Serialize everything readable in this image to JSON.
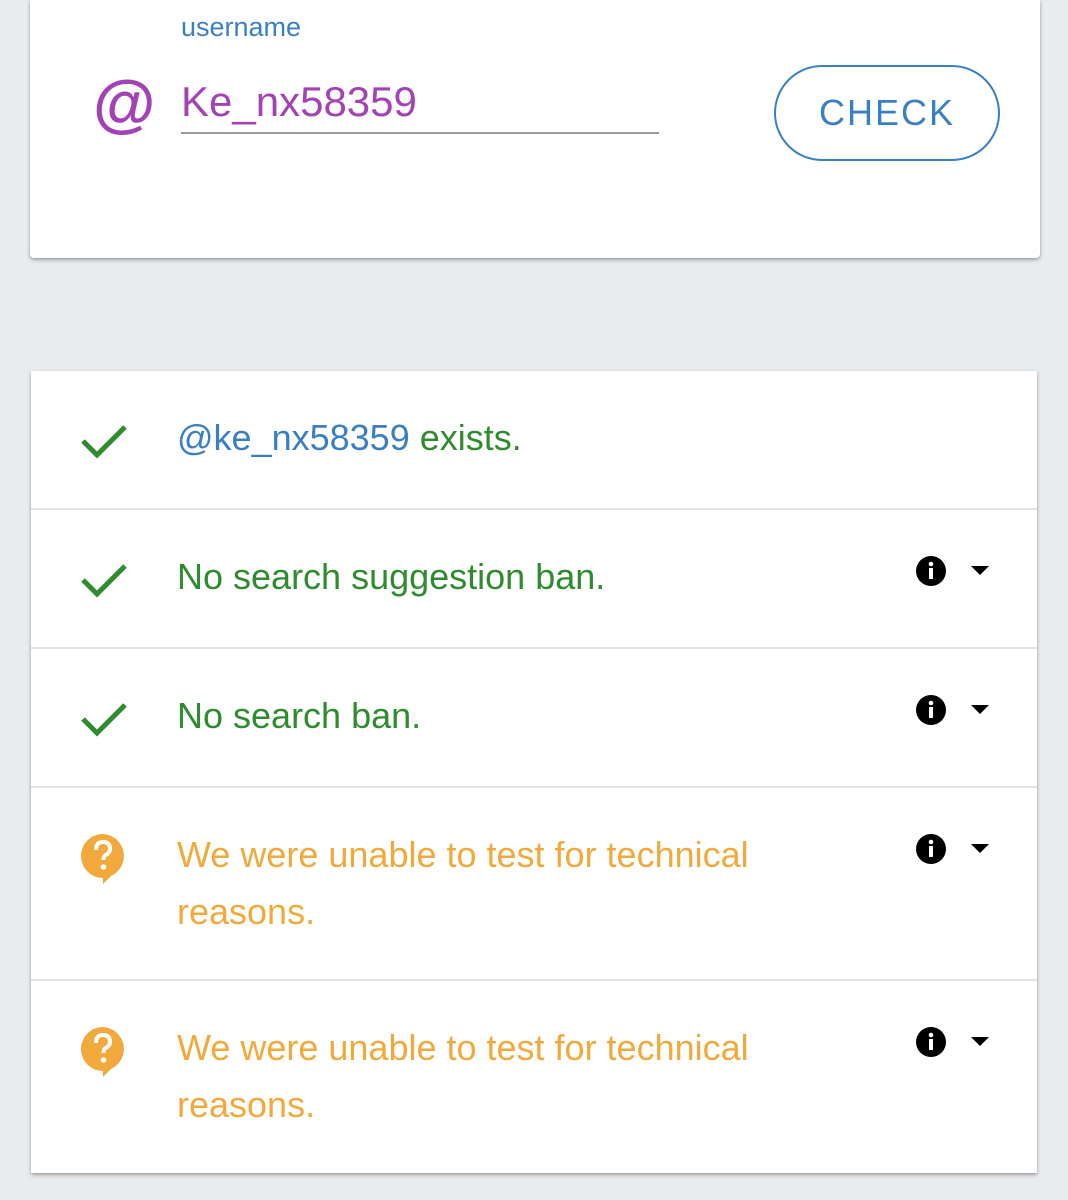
{
  "form": {
    "label": "username",
    "at_symbol": "@",
    "input_value": "Ke_nx58359",
    "check_label": "CHECK"
  },
  "results": [
    {
      "status": "ok",
      "icon": "check-icon",
      "handle": "@ke_nx58359",
      "text": " exists."
    },
    {
      "status": "ok",
      "icon": "check-icon",
      "text": "No search suggestion ban."
    },
    {
      "status": "ok",
      "icon": "check-icon",
      "text": "No search ban."
    },
    {
      "status": "unknown",
      "icon": "question-bubble-icon",
      "text_line1": "We were unable to test for technical",
      "text_line2": "reasons."
    },
    {
      "status": "unknown",
      "icon": "question-bubble-icon",
      "text_line1": "We were unable to test for technical",
      "text_line2": "reasons."
    }
  ],
  "colors": {
    "accent_blue": "#3a7fc4",
    "purple": "#a342b4",
    "success_green": "#2e8b2e",
    "warning_orange": "#f2a93b"
  }
}
